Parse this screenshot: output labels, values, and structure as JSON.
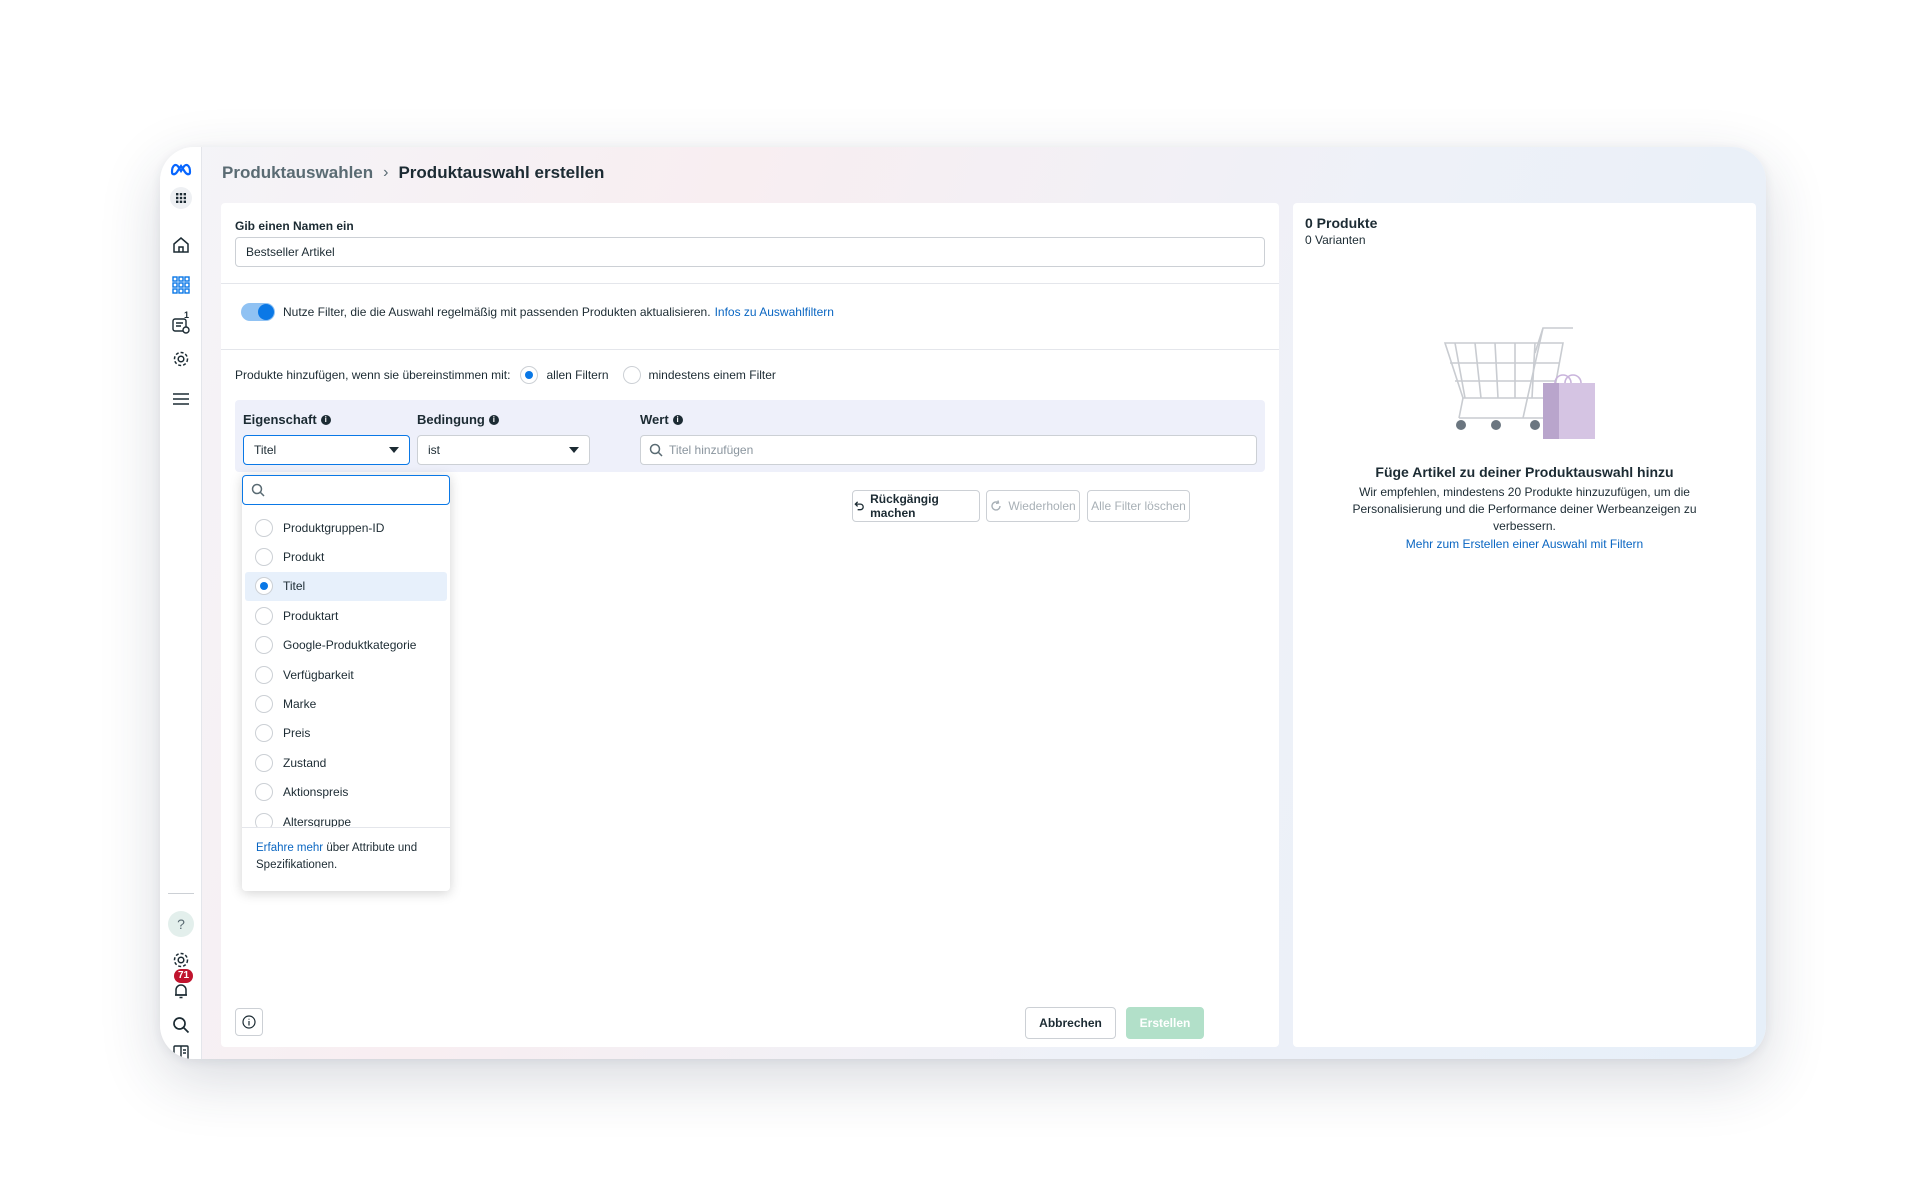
{
  "breadcrumb": {
    "parent": "Produktauswahlen",
    "current": "Produktauswahl erstellen"
  },
  "rail": {
    "notifications_badge": "1",
    "alerts_badge": "71",
    "icons": [
      "meta-logo-icon",
      "apps-grid-icon",
      "home-icon",
      "catalog-grid-icon",
      "data-sources-icon",
      "settings-icon",
      "menu-icon",
      "help-icon",
      "settings-icon",
      "notifications-icon",
      "search-icon",
      "panel-icon"
    ]
  },
  "form": {
    "name_label": "Gib einen Namen ein",
    "name_value": "Bestseller Artikel",
    "toggle_text": "Nutze Filter, die die Auswahl regelmäßig mit passenden Produkten aktualisieren.",
    "toggle_link": "Infos zu Auswahlfiltern",
    "match_text": "Produkte hinzufügen, wenn sie übereinstimmen mit:",
    "match_all": "allen Filtern",
    "match_any": "mindestens einem Filter",
    "col_property": "Eigenschaft",
    "col_condition": "Bedingung",
    "col_value": "Wert",
    "property_value": "Titel",
    "condition_value": "ist",
    "value_placeholder": "Titel hinzufügen",
    "undo": "Rückgängig machen",
    "redo": "Wiederholen",
    "clear": "Alle Filter löschen",
    "cancel": "Abbrechen",
    "create": "Erstellen"
  },
  "dropdown": {
    "search_placeholder": "",
    "items": [
      "Produktgruppen-ID",
      "Produkt",
      "Titel",
      "Produktart",
      "Google-Produktkategorie",
      "Verfügbarkeit",
      "Marke",
      "Preis",
      "Zustand",
      "Aktionspreis",
      "Altersgruppe"
    ],
    "selected": "Titel",
    "footer_link": "Erfahre mehr",
    "footer_text": "über Attribute und Spezifikationen."
  },
  "summary": {
    "products": "0 Produkte",
    "variants": "0 Varianten",
    "empty_title": "Füge Artikel zu deiner Produktauswahl hinzu",
    "empty_text": "Wir empfehlen, mindestens 20 Produkte hinzuzufügen, um die Personalisierung und die Performance deiner Werbeanzeigen zu verbessern.",
    "empty_link": "Mehr zum Erstellen einer Auswahl mit Filtern"
  },
  "colors": {
    "accent": "#0a78e6",
    "link": "#0a66c2",
    "primary_disabled": "#b2e0c9",
    "badge": "#c0142e"
  }
}
